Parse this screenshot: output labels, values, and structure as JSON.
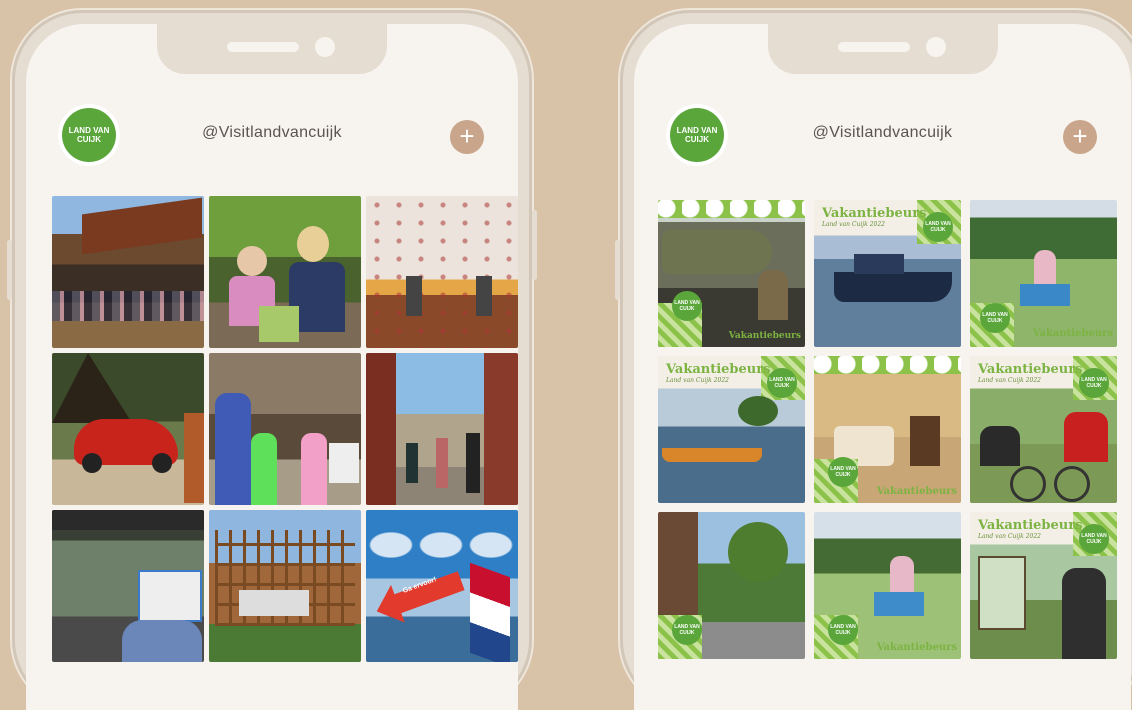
{
  "phones": [
    {
      "handle": "@Visitlandvancuijk",
      "logo_text": "LAND VAN CUIJK",
      "plus_icon": "+",
      "tiles": [
        {
          "name": "restaurant-terrace-photo"
        },
        {
          "name": "kids-crafting-photo"
        },
        {
          "name": "autumn-leaves-photo"
        },
        {
          "name": "red-car-photo"
        },
        {
          "name": "farm-visit-photo"
        },
        {
          "name": "old-street-photo"
        },
        {
          "name": "reading-in-tent-photo"
        },
        {
          "name": "wooden-house-photo"
        },
        {
          "name": "flag-arrow-photo",
          "arrow_text": "Ga ervoor!"
        }
      ]
    },
    {
      "handle": "@Visitlandvancuijk",
      "logo_text": "LAND VAN CUIJK",
      "plus_icon": "+",
      "vakantiebeurs": "Vakantiebeurs",
      "vakantiebeurs_sub": "Land van Cuijk 2022",
      "tiles": [
        {
          "name": "airplane-museum-photo"
        },
        {
          "name": "boat-photo"
        },
        {
          "name": "girl-on-bench-photo"
        },
        {
          "name": "river-boat-photo"
        },
        {
          "name": "hotel-room-photo"
        },
        {
          "name": "cyclists-photo"
        },
        {
          "name": "village-street-photo"
        },
        {
          "name": "child-sitting-photo"
        },
        {
          "name": "map-board-photo"
        }
      ]
    }
  ],
  "colors": {
    "background": "#d8c3a9",
    "accent_green": "#5aa63b",
    "plus_button": "#c8a58b"
  }
}
